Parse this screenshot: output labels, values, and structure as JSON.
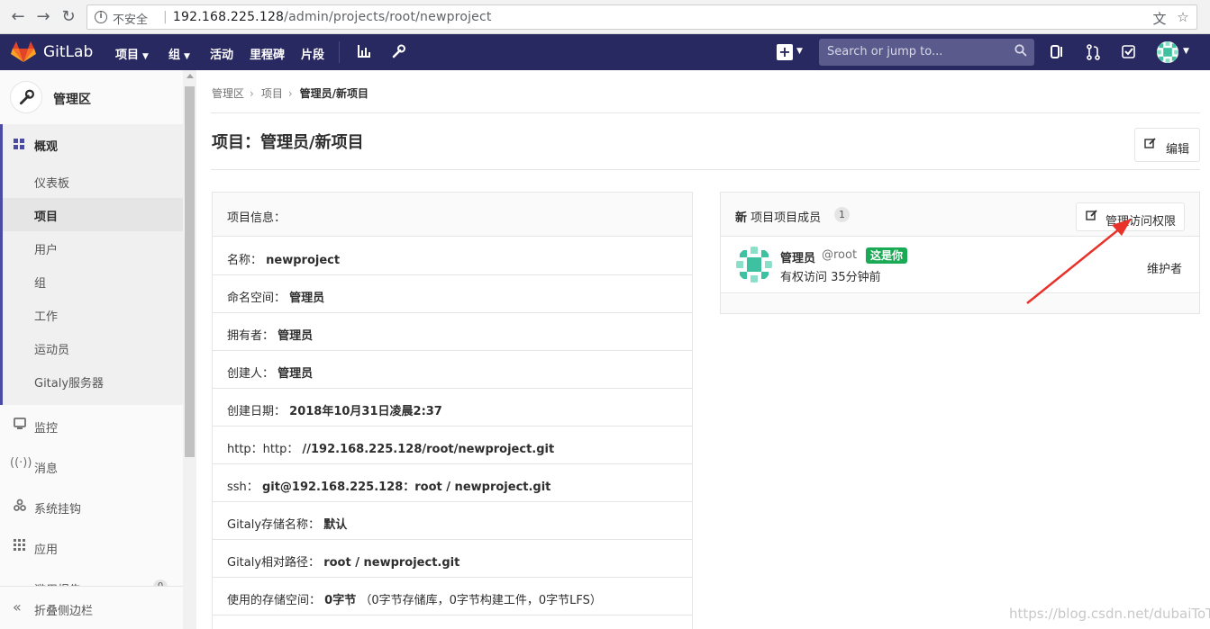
{
  "browser": {
    "insecure_label": "不安全",
    "url_host": "192.168.225.128",
    "url_path": "/admin/projects/root/newproject"
  },
  "header": {
    "brand": "GitLab",
    "menu": [
      "项目",
      "组",
      "活动",
      "里程碑",
      "片段"
    ],
    "search_placeholder": "Search or jump to..."
  },
  "sidebar": {
    "title": "管理区",
    "overview": "概观",
    "overview_items": [
      "仪表板",
      "项目",
      "用户",
      "组",
      "工作",
      "运动员",
      "Gitaly服务器"
    ],
    "active_item": "项目",
    "top_items": [
      "监控",
      "消息",
      "系统挂钩",
      "应用",
      "滥用报告"
    ],
    "abuse_count": "0",
    "collapse": "折叠侧边栏"
  },
  "breadcrumb": [
    "管理区",
    "项目",
    "管理员/新项目"
  ],
  "page": {
    "title": "项目：管理员/新项目",
    "edit_label": "编辑"
  },
  "info_panel": {
    "heading": "项目信息：",
    "rows": [
      {
        "k": "名称：",
        "v": "newproject"
      },
      {
        "k": "命名空间：",
        "v": "管理员"
      },
      {
        "k": "拥有者：",
        "v": "管理员"
      },
      {
        "k": "创建人：",
        "v": "管理员"
      },
      {
        "k": "创建日期：",
        "v": "2018年10月31日凌晨2:37"
      },
      {
        "k": "http：http：",
        "v": "//192.168.225.128/root/newproject.git"
      },
      {
        "k": "ssh：",
        "v": "git@192.168.225.128：root / newproject.git"
      },
      {
        "k": "Gitaly存储名称：",
        "v": "默认"
      },
      {
        "k": "Gitaly相对路径：",
        "v": "root / newproject.git"
      },
      {
        "k": "使用的存储空间：",
        "v": "0字节",
        "extra": "（0字节存储库，0字节构建工件，0字节LFS）"
      }
    ]
  },
  "members_panel": {
    "heading_bold": "新",
    "heading_rest": " 项目项目成员",
    "count": "1",
    "manage_label": "管理访问权限",
    "member": {
      "name": "管理员",
      "username": "@root",
      "you_badge": "这是你",
      "access": "有权访问 35分钟前",
      "role": "维护者"
    }
  },
  "watermark": "https://blog.csdn.net/dubaiToT",
  "colors": {
    "header_bg": "#292961",
    "sidebar_accent": "#4b4ba3",
    "you_badge": "#1aaa55",
    "annotation_arrow": "#e8322a"
  }
}
